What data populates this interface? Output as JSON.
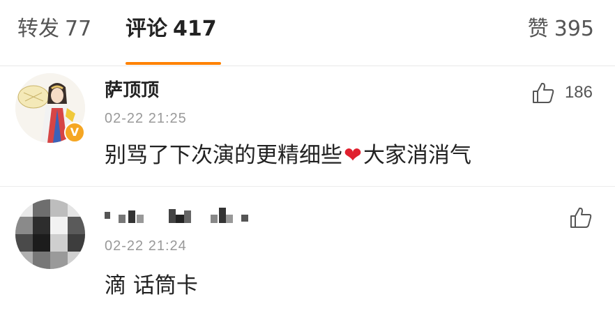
{
  "tabs": {
    "repost": {
      "label": "转发",
      "count": "77"
    },
    "comments": {
      "label": "评论",
      "count": "417"
    },
    "likes": {
      "label": "赞",
      "count": "395"
    }
  },
  "accent_color": "#ff8200",
  "comments": [
    {
      "username": "萨顶顶",
      "verified": true,
      "verified_badge_text": "V",
      "time": "02-22 21:25",
      "text_before": "别骂了下次演的更精细些",
      "emoji": "❤",
      "text_after": "大家消消气",
      "like_count": "186"
    },
    {
      "username_masked": true,
      "time": "02-22 21:24",
      "text": "滴 话筒卡"
    }
  ]
}
